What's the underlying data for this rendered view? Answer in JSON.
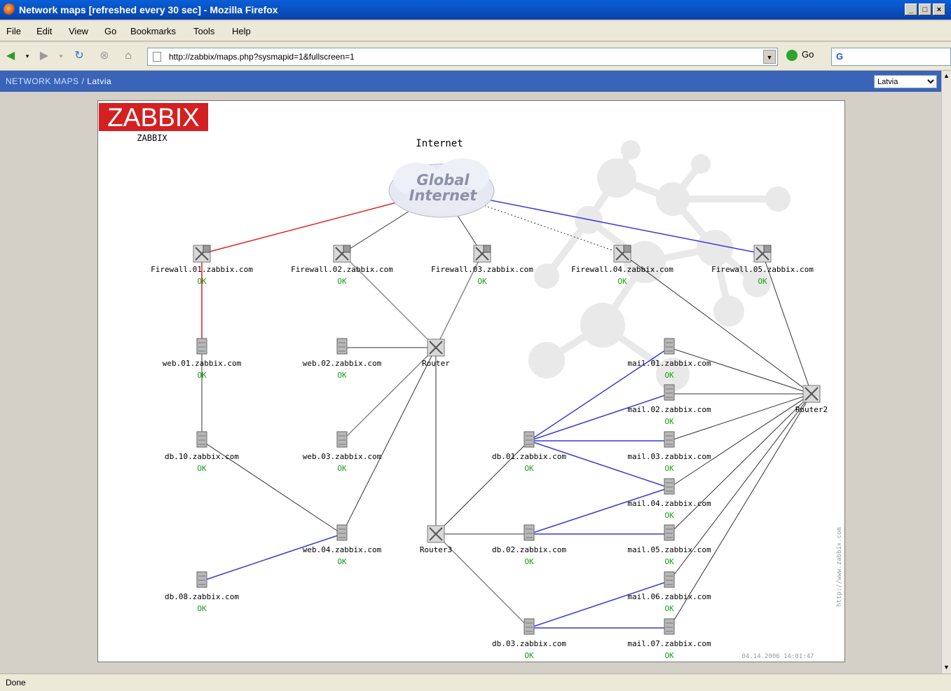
{
  "window": {
    "title": "Network maps [refreshed every 30 sec] - Mozilla Firefox",
    "minimize": "_",
    "maximize": "□",
    "close": "×"
  },
  "menu": [
    "File",
    "Edit",
    "View",
    "Go",
    "Bookmarks",
    "Tools",
    "Help"
  ],
  "navbar": {
    "url": "http://zabbix/maps.php?sysmapid=1&fullscreen=1",
    "go_label": "Go",
    "search_logo": "G"
  },
  "zabbix_bar": {
    "section": "NETWORK MAPS",
    "separator": " / ",
    "map_name": "Latvia",
    "select_value": "Latvia"
  },
  "map": {
    "logo_text": "ZABBIX",
    "logo_sub": "ZABBIX",
    "title": "Internet",
    "cloud_line1": "Global",
    "cloud_line2": "Internet",
    "timestamp": "04.14.2006 14:01:47",
    "vertical_url": "http://www.zabbix.com",
    "colors": {
      "ok": "#1aa01a",
      "red_link": "#e02020",
      "blue_link": "#3838d8",
      "logo_bg": "#d42020"
    },
    "nodes": [
      {
        "id": "fw1",
        "label": "Firewall.01.zabbix.com",
        "status": "OK",
        "icon": "firewall-icon"
      },
      {
        "id": "fw2",
        "label": "Firewall.02.zabbix.com",
        "status": "OK",
        "icon": "firewall-icon"
      },
      {
        "id": "fw3",
        "label": "Firewall.03.zabbix.com",
        "status": "OK",
        "icon": "firewall-icon"
      },
      {
        "id": "fw4",
        "label": "Firewall.04.zabbix.com",
        "status": "OK",
        "icon": "firewall-icon"
      },
      {
        "id": "fw5",
        "label": "Firewall.05.zabbix.com",
        "status": "OK",
        "icon": "firewall-icon"
      },
      {
        "id": "web1",
        "label": "web.01.zabbix.com",
        "status": "OK",
        "icon": "server-icon"
      },
      {
        "id": "web2",
        "label": "web.02.zabbix.com",
        "status": "OK",
        "icon": "server-icon"
      },
      {
        "id": "router",
        "label": "Router",
        "status": "",
        "icon": "router-icon"
      },
      {
        "id": "mail1",
        "label": "mail.01.zabbix.com",
        "status": "OK",
        "icon": "server-icon"
      },
      {
        "id": "mail2",
        "label": "mail.02.zabbix.com",
        "status": "OK",
        "icon": "server-icon"
      },
      {
        "id": "router2",
        "label": "Router2",
        "status": "",
        "icon": "router-icon"
      },
      {
        "id": "db10",
        "label": "db.10.zabbix.com",
        "status": "OK",
        "icon": "server-icon"
      },
      {
        "id": "web3",
        "label": "web.03.zabbix.com",
        "status": "OK",
        "icon": "server-icon"
      },
      {
        "id": "db1",
        "label": "db.01.zabbix.com",
        "status": "OK",
        "icon": "server-icon"
      },
      {
        "id": "mail3",
        "label": "mail.03.zabbix.com",
        "status": "OK",
        "icon": "server-icon"
      },
      {
        "id": "mail4",
        "label": "mail.04.zabbix.com",
        "status": "OK",
        "icon": "server-icon"
      },
      {
        "id": "web4",
        "label": "web.04.zabbix.com",
        "status": "OK",
        "icon": "server-icon"
      },
      {
        "id": "router3",
        "label": "Router3",
        "status": "",
        "icon": "router-icon"
      },
      {
        "id": "db2",
        "label": "db.02.zabbix.com",
        "status": "OK",
        "icon": "server-icon"
      },
      {
        "id": "mail5",
        "label": "mail.05.zabbix.com",
        "status": "OK",
        "icon": "server-icon"
      },
      {
        "id": "db8",
        "label": "db.08.zabbix.com",
        "status": "OK",
        "icon": "server-icon"
      },
      {
        "id": "mail6",
        "label": "mail.06.zabbix.com",
        "status": "OK",
        "icon": "server-icon"
      },
      {
        "id": "db3",
        "label": "db.03.zabbix.com",
        "status": "OK",
        "icon": "server-icon"
      },
      {
        "id": "mail7",
        "label": "mail.07.zabbix.com",
        "status": "OK",
        "icon": "server-icon"
      }
    ],
    "links": [
      {
        "from": "cloud",
        "to": "fw1",
        "color": "red"
      },
      {
        "from": "cloud",
        "to": "fw2",
        "color": "black"
      },
      {
        "from": "cloud",
        "to": "fw3",
        "color": "black"
      },
      {
        "from": "cloud",
        "to": "fw4",
        "color": "dotted"
      },
      {
        "from": "cloud",
        "to": "fw5",
        "color": "blue"
      },
      {
        "from": "fw1",
        "to": "web1",
        "color": "red"
      },
      {
        "from": "fw2",
        "to": "router",
        "color": "gray"
      },
      {
        "from": "fw3",
        "to": "router",
        "color": "gray"
      },
      {
        "from": "fw4",
        "to": "router2",
        "color": "black"
      },
      {
        "from": "fw5",
        "to": "router2",
        "color": "black"
      },
      {
        "from": "web2",
        "to": "router",
        "color": "black"
      },
      {
        "from": "web1",
        "to": "db10",
        "color": "black"
      },
      {
        "from": "db10",
        "to": "web4",
        "color": "black"
      },
      {
        "from": "router",
        "to": "web3",
        "color": "gray"
      },
      {
        "from": "router",
        "to": "web4",
        "color": "black"
      },
      {
        "from": "router",
        "to": "router3",
        "color": "black"
      },
      {
        "from": "web4",
        "to": "db8",
        "color": "blue"
      },
      {
        "from": "router3",
        "to": "db1",
        "color": "black"
      },
      {
        "from": "router3",
        "to": "db2",
        "color": "black"
      },
      {
        "from": "router3",
        "to": "db3",
        "color": "gray"
      },
      {
        "from": "db1",
        "to": "mail1",
        "color": "blue"
      },
      {
        "from": "db1",
        "to": "mail2",
        "color": "blue"
      },
      {
        "from": "db1",
        "to": "mail3",
        "color": "blue"
      },
      {
        "from": "db1",
        "to": "mail4",
        "color": "blue"
      },
      {
        "from": "db2",
        "to": "mail4",
        "color": "blue"
      },
      {
        "from": "db2",
        "to": "mail5",
        "color": "blue"
      },
      {
        "from": "db3",
        "to": "mail6",
        "color": "blue"
      },
      {
        "from": "db3",
        "to": "mail7",
        "color": "blue"
      },
      {
        "from": "mail1",
        "to": "router2",
        "color": "black"
      },
      {
        "from": "mail2",
        "to": "router2",
        "color": "black"
      },
      {
        "from": "mail3",
        "to": "router2",
        "color": "black"
      },
      {
        "from": "mail4",
        "to": "router2",
        "color": "black"
      },
      {
        "from": "mail5",
        "to": "router2",
        "color": "black"
      },
      {
        "from": "mail6",
        "to": "router2",
        "color": "black"
      },
      {
        "from": "mail7",
        "to": "router2",
        "color": "black"
      }
    ]
  },
  "status_text": "Done"
}
